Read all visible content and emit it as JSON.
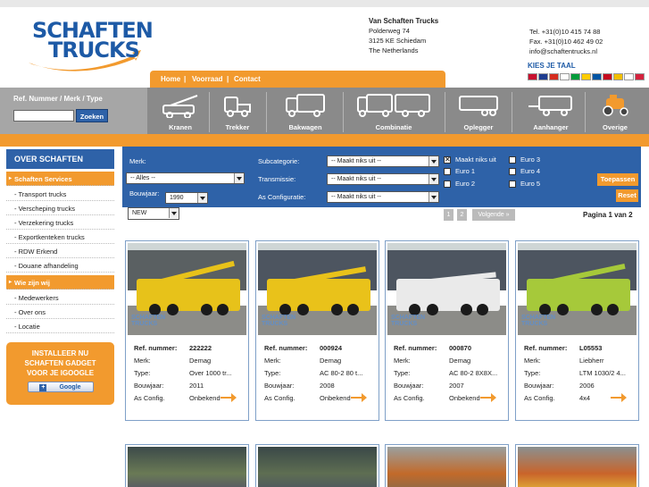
{
  "brand": {
    "line1": "SCHAFTEN",
    "line2": "TRUCKS"
  },
  "address": {
    "company": "Van Schaften Trucks",
    "street": "Polderweg 74",
    "city": "3125 KE Schiedam",
    "country": "The Netherlands"
  },
  "contact": {
    "tel": "Tel. +31(0)10 415 74 88",
    "fax": "Fax. +31(0)10 462 49 02",
    "email": "info@schaftentrucks.nl"
  },
  "language": {
    "title": "KIES JE TAAL",
    "flags": [
      "#c8102e",
      "#1d3c8f",
      "#d52b1e",
      "#ffffff",
      "#009c3b",
      "#ffcc00",
      "#0055a4",
      "#c60b1e",
      "#f1bf00",
      "#ffffff",
      "#d4213d"
    ]
  },
  "topnav": [
    "Home",
    "Voorraad",
    "Contact"
  ],
  "topnav_sep": "|",
  "search": {
    "label": "Ref. Nummer / Merk / Type",
    "placeholder": "",
    "button": "Zoeken"
  },
  "categories": [
    "Kranen",
    "Trekker",
    "Bakwagen",
    "Combinatie",
    "Oplegger",
    "Aanhanger",
    "Overige"
  ],
  "sidebar": {
    "title": "OVER SCHAFTEN",
    "section1": "Schaften Services",
    "items1": [
      "- Transport trucks",
      "- Verscheping trucks",
      "- Verzekering trucks",
      "- Exportkenteken trucks",
      "- RDW Erkend",
      "- Douane afhandeling"
    ],
    "section2": "Wie zijn wij",
    "items2": [
      "- Medewerkers",
      "- Over ons",
      "- Locatie"
    ],
    "gadget": {
      "line1": "INSTALLEER NU",
      "line2": "SCHAFTEN GADGET",
      "line3": "VOOR JE IGOOGLE",
      "button": "Google"
    }
  },
  "filters": {
    "merk_label": "Merk:",
    "merk_value": "-- Alles --",
    "bouwjaar_label": "Bouwjaar:",
    "bouwjaar_value": "1990",
    "subcategorie_label": "Subcategorie:",
    "subcategorie_value": "-- Maakt niks uit --",
    "transmissie_label": "Transmissie:",
    "transmissie_value": "-- Maakt niks uit --",
    "asconfig_label": "As Configuratie:",
    "asconfig_value": "-- Maakt niks uit --",
    "euro": [
      {
        "label": "Maakt niks uit",
        "checked": true
      },
      {
        "label": "Euro 1",
        "checked": false
      },
      {
        "label": "Euro 2",
        "checked": false
      },
      {
        "label": "Euro 3",
        "checked": false
      },
      {
        "label": "Euro 4",
        "checked": false
      },
      {
        "label": "Euro 5",
        "checked": false
      }
    ],
    "apply": "Toepassen",
    "reset": "Reset"
  },
  "sort": {
    "value": "NEW"
  },
  "pagination": {
    "pages": [
      "1",
      "2"
    ],
    "next": "Volgende »",
    "status": "Pagina 1 van 2"
  },
  "labels": {
    "ref": "Ref. nummer:",
    "merk": "Merk:",
    "type": "Type:",
    "bouwjaar": "Bouwjaar:",
    "asconfig": "As Config."
  },
  "watermark": {
    "line1": "SCHAFTEN",
    "line2": "TRUCKS"
  },
  "listings": [
    {
      "ref": "222222",
      "merk": "Demag",
      "type": "Over 1000 tr...",
      "bouwjaar": "2011",
      "asconfig": "Onbekend",
      "color": "#e7c21a",
      "has_arrow": true
    },
    {
      "ref": "000924",
      "merk": "Demag",
      "type": "AC 80-2 80 t...",
      "bouwjaar": "2008",
      "asconfig": "Onbekend",
      "color": "#e9c21a",
      "has_arrow": true
    },
    {
      "ref": "000870",
      "merk": "Demag",
      "type": "AC 80-2 8X8X...",
      "bouwjaar": "2007",
      "asconfig": "Onbekend",
      "color": "#eaeaea",
      "has_arrow": true
    },
    {
      "ref": "L05553",
      "merk": "Liebherr",
      "type": "LTM 1030/2 4...",
      "bouwjaar": "2006",
      "asconfig": "4x4",
      "color": "#a6c93a",
      "has_arrow": true
    }
  ],
  "colors": {
    "orange": "#f29a2e",
    "blue": "#2e62a8",
    "gray": "#8a8a8a"
  }
}
